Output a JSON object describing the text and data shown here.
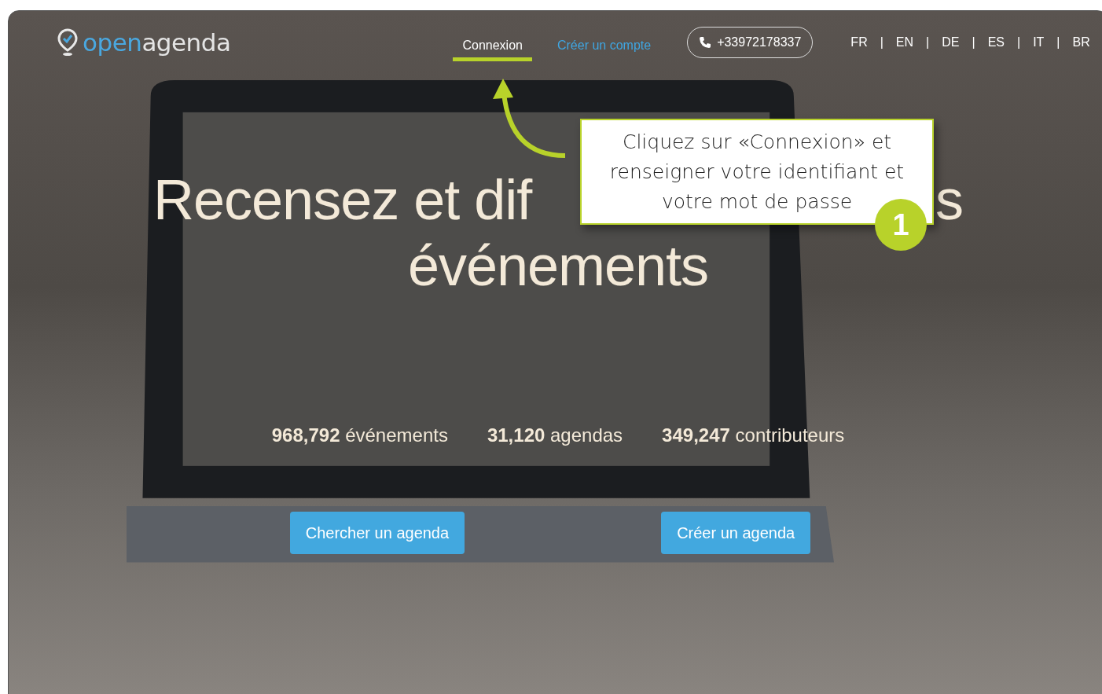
{
  "logo": {
    "part_1": "open",
    "part_2": "agenda"
  },
  "nav": {
    "links": [
      {
        "label": "Connexion",
        "selected": true
      },
      {
        "label": "Créer un compte",
        "selected": false
      }
    ],
    "phone": "+33972178337",
    "languages": [
      "FR",
      "EN",
      "DE",
      "ES",
      "IT",
      "BR"
    ],
    "language_separator": "|"
  },
  "headline": {
    "line_1_left": "Recensez et dif",
    "line_1_right": "s",
    "line_2": "événements"
  },
  "stats": [
    "**968,792** événements",
    "**31,120** agendas",
    "**349,247** contributeurs"
  ],
  "buttons": [
    "Chercher un agenda",
    "Créer un agenda"
  ],
  "callout": {
    "text": "Cliquez sur «Connexion» et renseigner votre identifiant et votre mot de passe",
    "step": "1"
  }
}
